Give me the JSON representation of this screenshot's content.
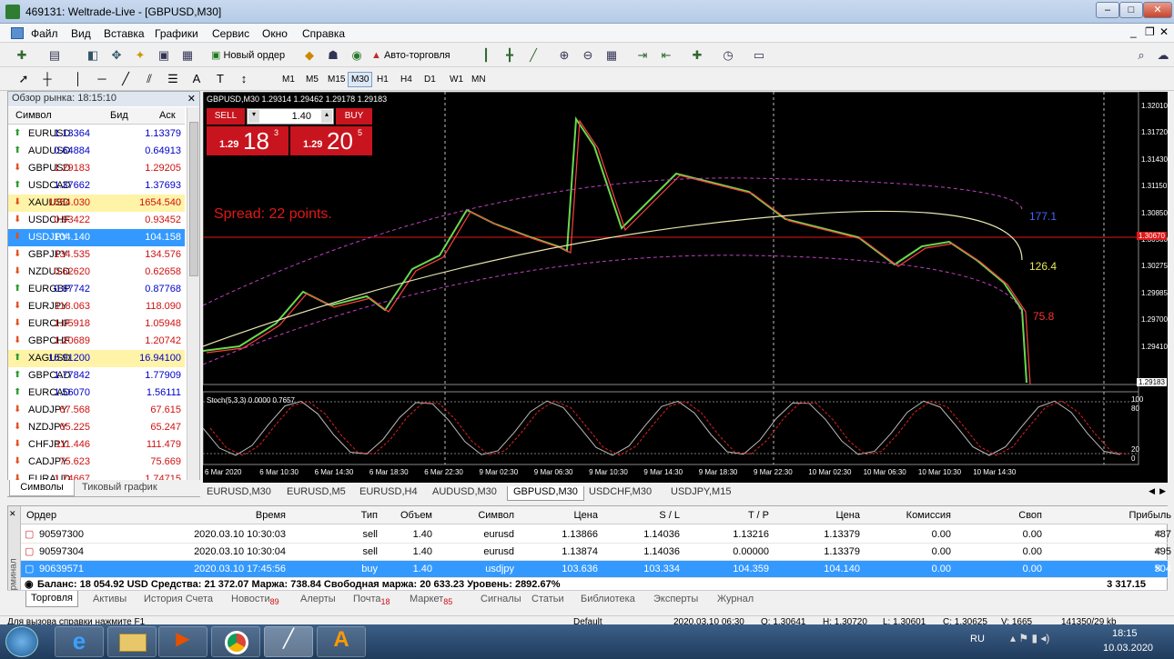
{
  "window": {
    "title": "469131: Weltrade-Live - [GBPUSD,M30]"
  },
  "menu": [
    "Файл",
    "Вид",
    "Вставка",
    "Графики",
    "Сервис",
    "Окно",
    "Справка"
  ],
  "toolbar": {
    "new_order": "Новый ордер",
    "autotrading": "Авто-торговля"
  },
  "timeframes": [
    "M1",
    "M5",
    "M15",
    "M30",
    "H1",
    "H4",
    "D1",
    "W1",
    "MN"
  ],
  "timeframe_selected": "M30",
  "market_watch": {
    "title": "Обзор рынка: 18:15:10",
    "cols": {
      "symbol": "Символ",
      "bid": "Бид",
      "ask": "Аск"
    },
    "rows": [
      {
        "s": "EURUSD",
        "b": "1.13364",
        "a": "1.13379",
        "dir": "up"
      },
      {
        "s": "AUDUSD",
        "b": "0.64884",
        "a": "0.64913",
        "dir": "up"
      },
      {
        "s": "GBPUSD",
        "b": "1.29183",
        "a": "1.29205",
        "dir": "down"
      },
      {
        "s": "USDCAD",
        "b": "1.37662",
        "a": "1.37693",
        "dir": "up"
      },
      {
        "s": "XAUUSD",
        "b": "1654.030",
        "a": "1654.540",
        "dir": "down"
      },
      {
        "s": "USDCHF",
        "b": "0.93422",
        "a": "0.93452",
        "dir": "down"
      },
      {
        "s": "USDJPY",
        "b": "104.140",
        "a": "104.158",
        "dir": "down"
      },
      {
        "s": "GBPJPY",
        "b": "134.535",
        "a": "134.576",
        "dir": "down"
      },
      {
        "s": "NZDUSD",
        "b": "0.62620",
        "a": "0.62658",
        "dir": "down"
      },
      {
        "s": "EURGBP",
        "b": "0.87742",
        "a": "0.87768",
        "dir": "up"
      },
      {
        "s": "EURJPY",
        "b": "118.063",
        "a": "118.090",
        "dir": "down"
      },
      {
        "s": "EURCHF",
        "b": "1.05918",
        "a": "1.05948",
        "dir": "down"
      },
      {
        "s": "GBPCHF",
        "b": "1.20689",
        "a": "1.20742",
        "dir": "down"
      },
      {
        "s": "XAGUSD",
        "b": "16.91200",
        "a": "16.94100",
        "dir": "up"
      },
      {
        "s": "GBPCAD",
        "b": "1.77842",
        "a": "1.77909",
        "dir": "up"
      },
      {
        "s": "EURCAD",
        "b": "1.56070",
        "a": "1.56111",
        "dir": "up"
      },
      {
        "s": "AUDJPY",
        "b": "67.568",
        "a": "67.615",
        "dir": "down"
      },
      {
        "s": "NZDJPY",
        "b": "65.225",
        "a": "65.247",
        "dir": "down"
      },
      {
        "s": "CHFJPY",
        "b": "111.446",
        "a": "111.479",
        "dir": "down"
      },
      {
        "s": "CADJPY",
        "b": "75.623",
        "a": "75.669",
        "dir": "down"
      },
      {
        "s": "EURAUD",
        "b": "1.74667",
        "a": "1.74715",
        "dir": "down"
      }
    ],
    "tabs": [
      "Символы",
      "Тиковый график"
    ]
  },
  "chart": {
    "header": "GBPUSD,M30  1.29314 1.29462 1.29178 1.29183",
    "sell_label": "SELL",
    "buy_label": "BUY",
    "lot": "1.40",
    "sell_big": "18",
    "sell_small": "1.29",
    "sell_sup": "3",
    "buy_big": "20",
    "buy_small": "1.29",
    "buy_sup": "5",
    "spread": "Spread: 22 points.",
    "levels": [
      {
        "t": "177.1",
        "c": "#4466ff"
      },
      {
        "t": "126.4",
        "c": "#e8e85a"
      },
      {
        "t": "75.8",
        "c": "#ff3030"
      }
    ],
    "price_ticks": [
      "1.32010",
      "1.31720",
      "1.31430",
      "1.31150",
      "1.30850",
      "1.30560",
      "1.30275",
      "1.29985",
      "1.29700",
      "1.29410"
    ],
    "current_price": "1.29183",
    "bid_line_price": "1.30670",
    "stoch_label": "Stoch(5,3,3) 0.0000 0.7657",
    "stoch_ticks": [
      "100",
      "80",
      "20",
      "0"
    ],
    "time_ticks": [
      "6 Mar 2020",
      "6 Mar 10:30",
      "6 Mar 14:30",
      "6 Mar 18:30",
      "6 Mar 22:30",
      "9 Mar 02:30",
      "9 Mar 06:30",
      "9 Mar 10:30",
      "9 Mar 14:30",
      "9 Mar 18:30",
      "9 Mar 22:30",
      "10 Mar 02:30",
      "10 Mar 06:30",
      "10 Mar 10:30",
      "10 Mar 14:30"
    ]
  },
  "chart_tabs": [
    "EURUSD,M30",
    "EURUSD,M5",
    "EURUSD,H4",
    "AUDUSD,M30",
    "GBPUSD,M30",
    "USDCHF,M30",
    "USDJPY,M15"
  ],
  "chart_tab_selected": "GBPUSD,M30",
  "terminal": {
    "cols": [
      "Ордер",
      "Время",
      "Тип",
      "Объем",
      "Символ",
      "Цена",
      "S / L",
      "T / P",
      "Цена",
      "Комиссия",
      "Своп",
      "Прибыль"
    ],
    "rows": [
      [
        "90597300",
        "2020.03.10 10:30:03",
        "sell",
        "1.40",
        "eurusd",
        "1.13866",
        "1.14036",
        "1.13216",
        "1.13379",
        "0.00",
        "0.00",
        "487"
      ],
      [
        "90597304",
        "2020.03.10 10:30:04",
        "sell",
        "1.40",
        "eurusd",
        "1.13874",
        "1.14036",
        "0.00000",
        "1.13379",
        "0.00",
        "0.00",
        "495"
      ],
      [
        "90639571",
        "2020.03.10 17:45:56",
        "buy",
        "1.40",
        "usdjpy",
        "103.636",
        "103.334",
        "104.359",
        "104.140",
        "0.00",
        "0.00",
        "504"
      ]
    ],
    "balance": "Баланс: 18 054.92 USD  Средства: 21 372.07  Маржа: 738.84  Свободная маржа: 20 633.23  Уровень: 2892.67%",
    "total": "3 317.15",
    "side_label": "Терминал",
    "tabs": [
      {
        "t": "Торговля",
        "n": ""
      },
      {
        "t": "Активы",
        "n": ""
      },
      {
        "t": "История Счета",
        "n": ""
      },
      {
        "t": "Новости",
        "n": "89"
      },
      {
        "t": "Алерты",
        "n": ""
      },
      {
        "t": "Почта",
        "n": "18"
      },
      {
        "t": "Маркет",
        "n": "85"
      },
      {
        "t": "Сигналы",
        "n": ""
      },
      {
        "t": "Статьи",
        "n": ""
      },
      {
        "t": "Библиотека",
        "n": ""
      },
      {
        "t": "Эксперты",
        "n": ""
      },
      {
        "t": "Журнал",
        "n": ""
      }
    ]
  },
  "status": {
    "help": "Для вызова справки нажмите F1",
    "profile": "Default",
    "time": "2020.03.10 06:30",
    "o": "O: 1.30641",
    "h": "H: 1.30720",
    "l": "L: 1.30601",
    "c": "C: 1.30625",
    "v": "V: 1665",
    "traffic": "141350/29 kb"
  },
  "taskbar": {
    "lang": "RU",
    "clock": "18:15",
    "date": "10.03.2020"
  }
}
